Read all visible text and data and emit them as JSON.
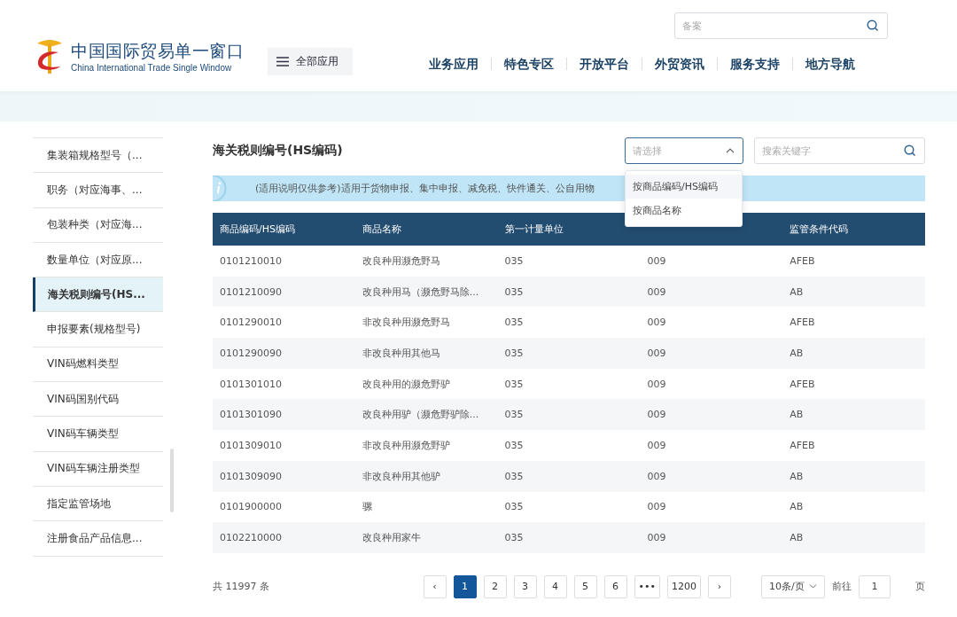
{
  "header": {
    "logo_title": "中国国际贸易单一窗口",
    "logo_subtitle": "China International Trade Single Window",
    "all_apps": "全部应用",
    "search": {
      "placeholder": "备案"
    },
    "nav": [
      "业务应用",
      "特色专区",
      "开放平台",
      "外贸资讯",
      "服务支持",
      "地方导航"
    ]
  },
  "sidebar": {
    "items": [
      {
        "label": "集装箱规格型号（...",
        "selected": false
      },
      {
        "label": "职务（对应海事、...",
        "selected": false
      },
      {
        "label": "包装种类（对应海...",
        "selected": false
      },
      {
        "label": "数量单位（对应原...",
        "selected": false
      },
      {
        "label": "海关税则编号(HS...",
        "selected": true
      },
      {
        "label": "申报要素(规格型号)",
        "selected": false
      },
      {
        "label": "VIN码燃料类型",
        "selected": false
      },
      {
        "label": "VIN码国别代码",
        "selected": false
      },
      {
        "label": "VIN码车辆类型",
        "selected": false
      },
      {
        "label": "VIN码车辆注册类型",
        "selected": false
      },
      {
        "label": "指定监管场地",
        "selected": false
      },
      {
        "label": "注册食品产品信息...",
        "selected": false
      }
    ]
  },
  "main": {
    "title": "海关税则编号(HS编码)",
    "select": {
      "placeholder": "请选择",
      "expanded": true,
      "options": [
        {
          "label": "按商品编码/HS编码",
          "selected": true
        },
        {
          "label": "按商品名称",
          "selected": false
        }
      ]
    },
    "keyword_search": {
      "placeholder": "搜索关键字"
    },
    "notice": "(适用说明仅供参考)适用于货物申报、集中申报、减免税、快件通关、公自用物",
    "table": {
      "columns": [
        "商品编码/HS编码",
        "商品名称",
        "第一计量单位",
        null,
        "监管条件代码"
      ],
      "rows": [
        [
          "0101210010",
          "改良种用濒危野马",
          "035",
          "009",
          "AFEB"
        ],
        [
          "0101210090",
          "改良种用马（濒危野马除...",
          "035",
          "009",
          "AB"
        ],
        [
          "0101290010",
          "非改良种用濒危野马",
          "035",
          "009",
          "AFEB"
        ],
        [
          "0101290090",
          "非改良种用其他马",
          "035",
          "009",
          "AB"
        ],
        [
          "0101301010",
          "改良种用的濒危野驴",
          "035",
          "009",
          "AFEB"
        ],
        [
          "0101301090",
          "改良种用驴（濒危野驴除...",
          "035",
          "009",
          "AB"
        ],
        [
          "0101309010",
          "非改良种用濒危野驴",
          "035",
          "009",
          "AFEB"
        ],
        [
          "0101309090",
          "非改良种用其他驴",
          "035",
          "009",
          "AB"
        ],
        [
          "0101900000",
          "骡",
          "035",
          "009",
          "AB"
        ],
        [
          "0102210000",
          "改良种用家牛",
          "035",
          "009",
          "AB"
        ]
      ]
    },
    "pagination": {
      "total": "共 11997 条",
      "prev": "‹",
      "next": "›",
      "pages": [
        {
          "label": "1",
          "selected": true
        },
        {
          "label": "2",
          "selected": false
        },
        {
          "label": "3",
          "selected": false
        },
        {
          "label": "4",
          "selected": false
        },
        {
          "label": "5",
          "selected": false
        },
        {
          "label": "6",
          "selected": false
        },
        {
          "label": "•••",
          "selected": false
        },
        {
          "label": "1200",
          "selected": false
        }
      ],
      "page_size": "10条/页",
      "goto_label": "前往",
      "goto_value": "1",
      "page_unit": "页"
    }
  }
}
